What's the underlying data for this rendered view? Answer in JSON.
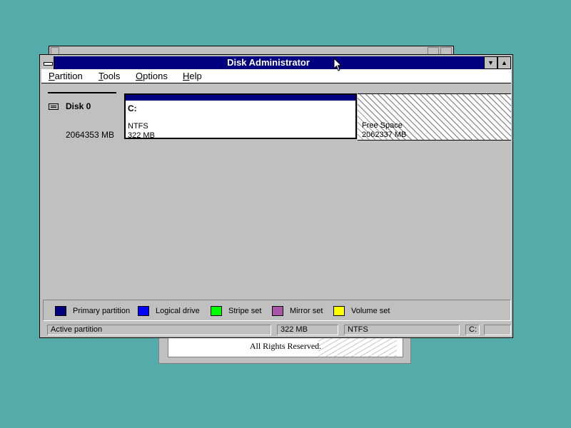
{
  "background_window": {
    "title": ""
  },
  "about": {
    "rights_text": "All Rights Reserved."
  },
  "window": {
    "title": "Disk Administrator"
  },
  "menu": [
    {
      "key": "P",
      "rest": "artition"
    },
    {
      "key": "T",
      "rest": "ools"
    },
    {
      "key": "O",
      "rest": "ptions"
    },
    {
      "key": "H",
      "rest": "elp"
    }
  ],
  "disk": {
    "name": "Disk 0",
    "size": "2064353 MB"
  },
  "partition_c": {
    "letter": "C:",
    "filesystem": "NTFS",
    "size": "322 MB",
    "color": "#000080"
  },
  "free_space": {
    "label": "Free Space",
    "size": "2062337 MB"
  },
  "legend": [
    {
      "label": "Primary partition",
      "color": "#000080"
    },
    {
      "label": "Logical drive",
      "color": "#0000ff"
    },
    {
      "label": "Stripe set",
      "color": "#00ff00"
    },
    {
      "label": "Mirror set",
      "color": "#aa55aa"
    },
    {
      "label": "Volume set",
      "color": "#ffff00"
    }
  ],
  "status": {
    "info": "Active partition",
    "size": "322 MB",
    "fs": "NTFS",
    "drive": "C:",
    "extra": ""
  },
  "colors": {
    "desktop": "#55aaaa",
    "titlebar": "#000080",
    "face": "#c0c0c0"
  }
}
